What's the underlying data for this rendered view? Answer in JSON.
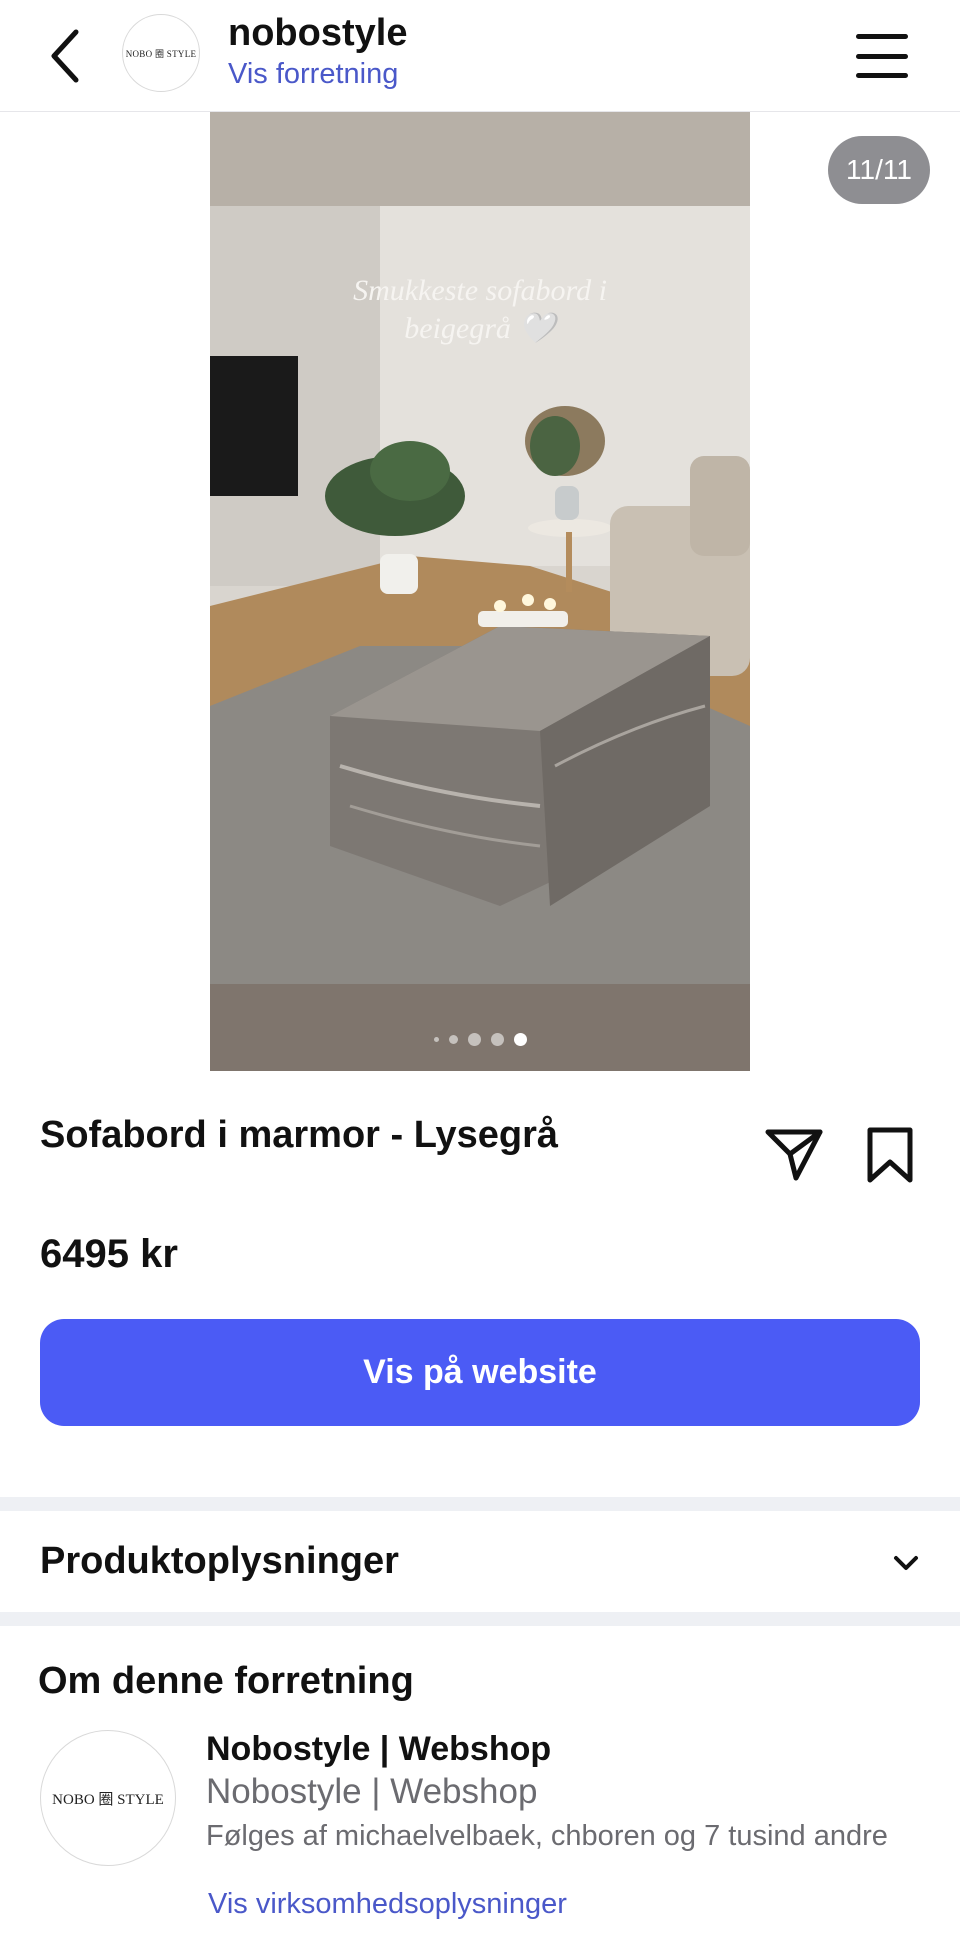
{
  "header": {
    "shop_name": "nobostyle",
    "shop_link": "Vis forretning",
    "logo_text": "NOBO 圈 STYLE"
  },
  "gallery": {
    "counter": "11/11",
    "overlay_text_line1": "Smukkeste sofabord i",
    "overlay_text_line2": "beigegrå 🤍",
    "total_dots": 5,
    "active_dot": 5
  },
  "product": {
    "title": "Sofabord i marmor - Lysegrå",
    "price": "6495 kr",
    "cta_label": "Vis på website"
  },
  "details": {
    "section_label": "Produktoplysninger"
  },
  "about": {
    "title": "Om denne forretning",
    "logo_text": "NOBO 圈 STYLE",
    "business_name": "Nobostyle | Webshop",
    "business_subtitle": "Nobostyle | Webshop",
    "followers_text": "Følges af michaelvelbaek, chboren og 7 tusind andre",
    "info_link": "Vis virksomhedsoplysninger"
  },
  "colors": {
    "accent": "#4b5bf5",
    "link": "#4a58c9",
    "separator": "#eef0f4"
  },
  "icons": [
    "back-arrow-icon",
    "menu-icon",
    "share-icon",
    "bookmark-icon",
    "chevron-down-icon"
  ]
}
